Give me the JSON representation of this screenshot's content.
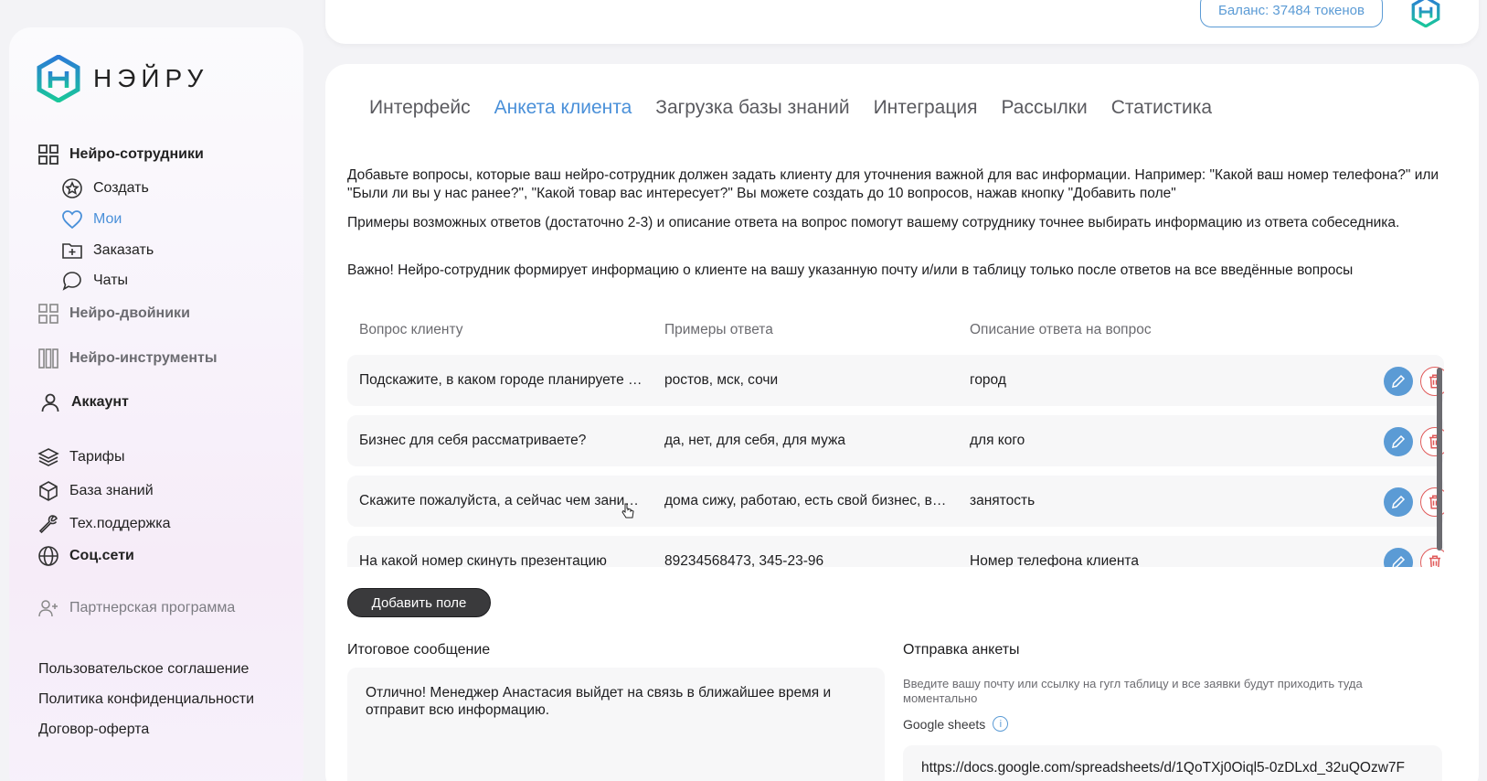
{
  "brand": {
    "name": "НЭЙРУ"
  },
  "sidebar": {
    "neuro_staff": "Нейро-сотрудники",
    "create": "Создать",
    "mine": "Мои",
    "order": "Заказать",
    "chats": "Чаты",
    "neuro_twins": "Нейро-двойники",
    "neuro_tools": "Нейро-инструменты",
    "account": "Аккаунт",
    "tariffs": "Тарифы",
    "knowledge_base": "База знаний",
    "support": "Тех.поддержка",
    "social": "Соц.сети",
    "partner": "Партнерская программа",
    "footer": [
      "Пользовательское соглашение",
      "Политика конфиденциальности",
      "Договор-оферта"
    ]
  },
  "topbar": {
    "balance": "Баланс: 37484 токенов"
  },
  "tabs": [
    "Интерфейс",
    "Анкета клиента",
    "Загрузка базы знаний",
    "Интеграция",
    "Рассылки",
    "Статистика"
  ],
  "active_tab": 1,
  "description": {
    "p1": "Добавьте вопросы, которые ваш нейро-сотрудник должен задать клиенту для уточнения важной для вас информации. Например: \"Какой ваш номер телефона?\" или \"Были ли вы у нас ранее?\", \"Какой товар вас интересует?\" Вы можете создать до 10 вопросов, нажав кнопку \"Добавить поле\"",
    "p2": "Примеры возможных ответов (достаточно 2-3) и описание ответа на вопрос помогут вашему сотруднику точнее выбирать информацию из ответа собеседника.",
    "p3": "Важно! Нейро-сотрудник формирует информацию о клиенте на вашу указанную почту и/или в таблицу только после ответов на все введённые вопросы"
  },
  "table": {
    "headers": [
      "Вопрос клиенту",
      "Примеры ответа",
      "Описание ответа на вопрос"
    ],
    "rows": [
      [
        "Подскажите, в каком городе планируете открытие?",
        "ростов, мск, сочи",
        "город"
      ],
      [
        "Бизнес для себя рассматриваете?",
        "да, нет, для себя, для мужа",
        "для кого"
      ],
      [
        "Скажите пожалуйста, а сейчас чем занимаетесь?",
        "дома сижу, работаю, есть свой бизнес, в декрете",
        "занятость"
      ],
      [
        "На какой номер скинуть презентацию",
        "89234568473, 345-23-96",
        "Номер телефона клиента"
      ]
    ]
  },
  "add_field": "Добавить поле",
  "final_message": {
    "label": "Итоговое сообщение",
    "text": "Отлично! Менеджер Анастасия выйдет на связь в ближайшее время и отправит всю информацию."
  },
  "send_form": {
    "label": "Отправка анкеты",
    "hint": "Введите вашу почту или ссылку на гугл таблицу и все заявки будут приходить туда моментально",
    "gs_label": "Google sheets",
    "gs_value": "https://docs.google.com/spreadsheets/d/1QoTXj0Oiql5-0zDLxd_32uQOzw7F"
  },
  "colors": {
    "accent": "#4a90d9",
    "danger": "#e05a5a",
    "dark_button": "#3a3a3c"
  }
}
